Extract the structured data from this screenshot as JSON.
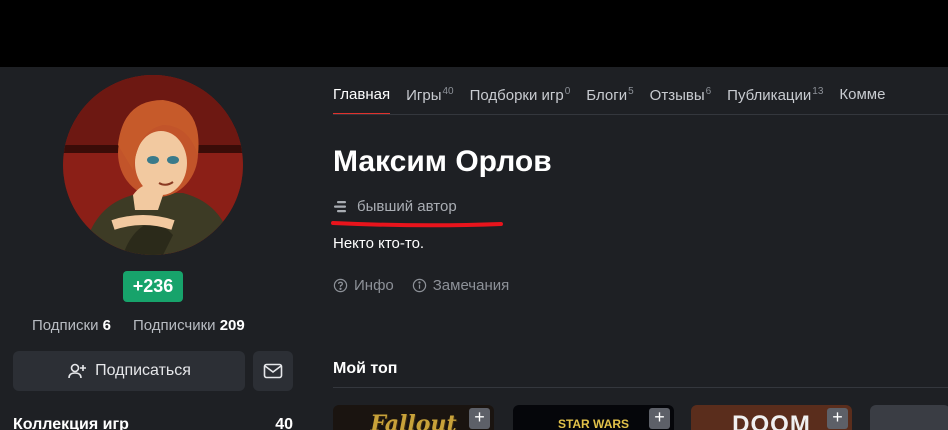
{
  "profile": {
    "name": "Максим Орлов",
    "role": "бывший автор",
    "bio": "Некто кто-то.",
    "rating": "+236"
  },
  "sidebar": {
    "subscriptions_label": "Подписки",
    "subscriptions_count": "6",
    "subscribers_label": "Подписчики",
    "subscribers_count": "209",
    "subscribe_button": "Подписаться",
    "collection_label": "Коллекция игр",
    "collection_count": "40"
  },
  "tabs": [
    {
      "label": "Главная",
      "count": ""
    },
    {
      "label": "Игры",
      "count": "40"
    },
    {
      "label": "Подборки игр",
      "count": "0"
    },
    {
      "label": "Блоги",
      "count": "5"
    },
    {
      "label": "Отзывы",
      "count": "6"
    },
    {
      "label": "Публикации",
      "count": "13"
    },
    {
      "label": "Комме",
      "count": ""
    }
  ],
  "links": {
    "info": "Инфо",
    "remarks": "Замечания"
  },
  "top_section": {
    "title": "Мой топ",
    "cards": [
      {
        "title": "Fallout",
        "add": "+"
      },
      {
        "title": "STAR WARS",
        "add": "+"
      },
      {
        "title": "DOOM",
        "add": "+"
      },
      {
        "title": "",
        "add": ""
      }
    ]
  },
  "colors": {
    "accent_red": "#e0312c",
    "rating_green": "#17a36b",
    "background": "#1e2024"
  }
}
